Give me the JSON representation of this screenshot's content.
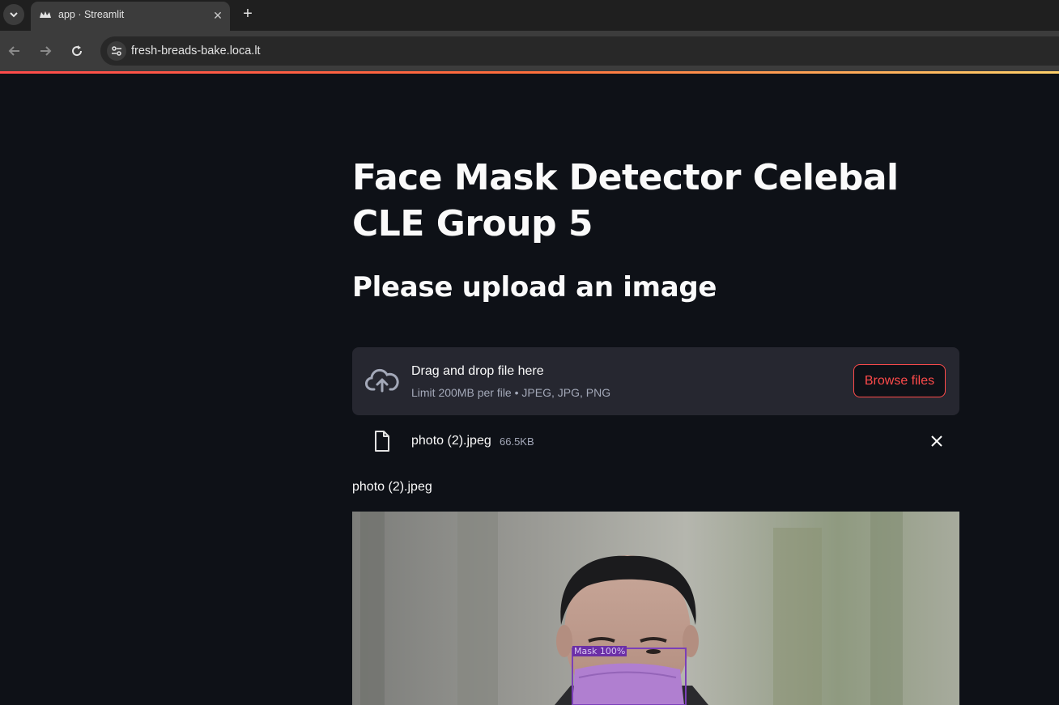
{
  "browser": {
    "tab_title": "app · Streamlit",
    "url": "fresh-breads-bake.loca.lt"
  },
  "app": {
    "title": "Face Mask Detector Celebal CLE Group 5",
    "subheader": "Please upload an image",
    "uploader": {
      "dropzone_title": "Drag and drop file here",
      "dropzone_limit": "Limit 200MB per file • JPEG, JPG, PNG",
      "browse_label": "Browse files",
      "accent_color": "#ff4b4b"
    },
    "uploaded_file": {
      "name": "photo (2).jpeg",
      "size": "66.5KB"
    },
    "image_caption": "photo (2).jpeg",
    "detection": {
      "label": "Mask 100%",
      "box_color": "#7b3fb8"
    }
  },
  "icons": {
    "tab_list": "chevron-down-icon",
    "favicon": "streamlit-crown-icon",
    "tab_close": "close-icon",
    "new_tab": "plus-icon",
    "back": "arrow-left-icon",
    "forward": "arrow-right-icon",
    "reload": "reload-icon",
    "site_info": "tune-icon",
    "upload": "cloud-upload-icon",
    "file": "file-icon",
    "remove": "close-icon"
  }
}
